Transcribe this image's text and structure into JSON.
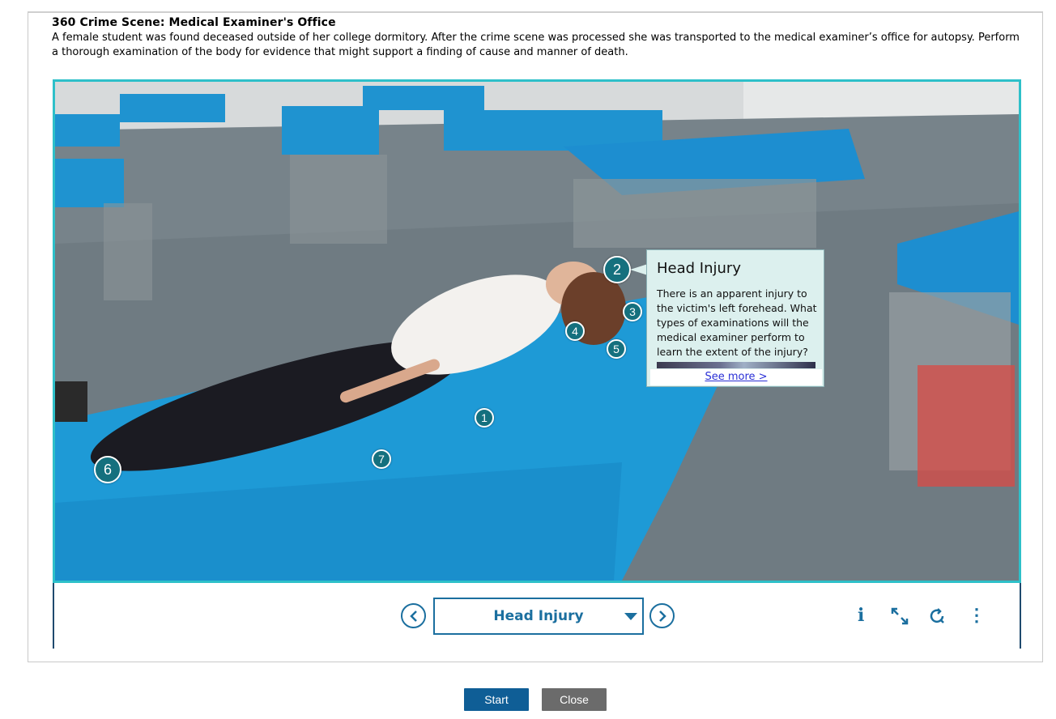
{
  "header": {
    "title": "360 Crime Scene: Medical Examiner's Office",
    "description": "A female student was found deceased outside of her college dormitory. After the crime scene was processed she was transported to the medical examiner’s office for autopsy. Perform a thorough examination of the body for evidence that might support a finding of cause and manner of death."
  },
  "viewer": {
    "hotspots": [
      "1",
      "2",
      "3",
      "4",
      "5",
      "6",
      "7"
    ],
    "popup": {
      "title": "Head Injury",
      "body": "There is an apparent injury to the victim's left forehead. What types of examinations will the medical examiner perform to learn the extent of the injury?",
      "link": "See more >"
    }
  },
  "toolbar": {
    "prev_icon": "chevron-left-icon",
    "next_icon": "chevron-right-icon",
    "selected": "Head Injury",
    "info_glyph": "i",
    "expand_icon": "expand-icon",
    "reset_icon": "reset-icon",
    "more_glyph": "⋮"
  },
  "buttons": {
    "start": "Start",
    "close": "Close"
  },
  "colors": {
    "accent": "#2ec0c9",
    "primary": "#1b6f9f",
    "hotspot": "#15707e"
  }
}
